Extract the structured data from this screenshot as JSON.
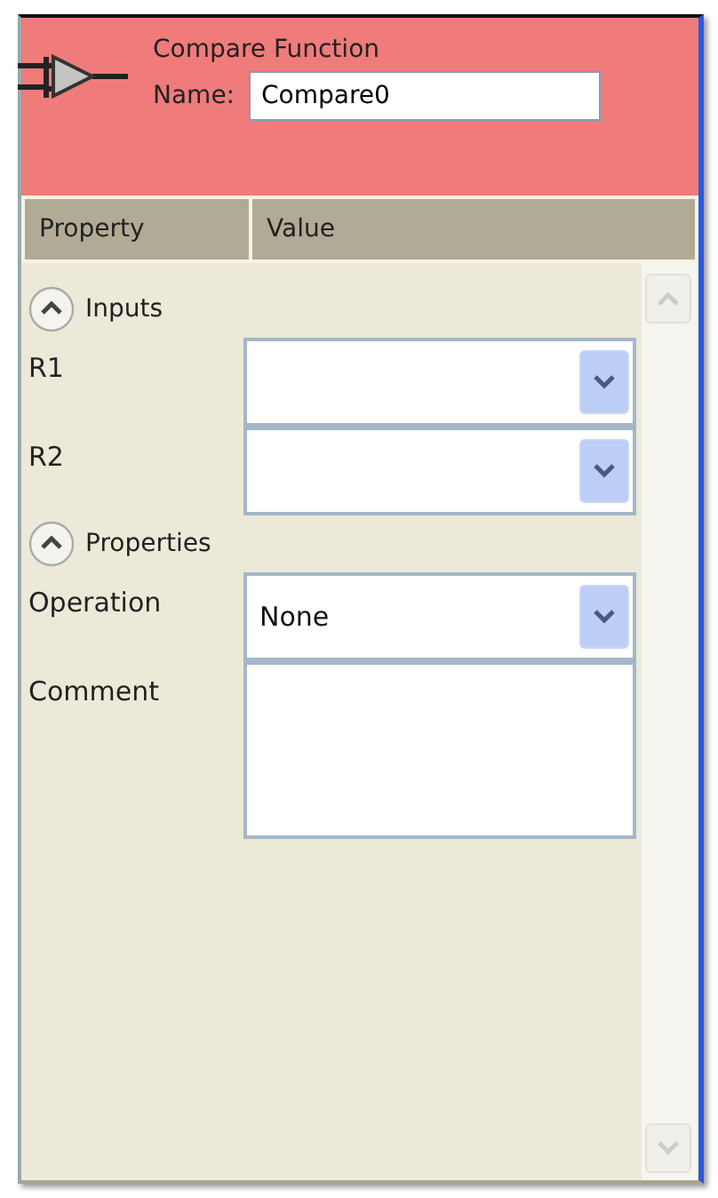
{
  "header": {
    "title": "Compare Function",
    "name_label": "Name:",
    "name_value": "Compare0"
  },
  "columns": [
    "Property",
    "Value"
  ],
  "sections": [
    {
      "label": "Inputs",
      "expanded": true,
      "rows": [
        {
          "label": "R1",
          "kind": "dropdown"
        },
        {
          "label": "R2",
          "kind": "dropdown"
        }
      ]
    },
    {
      "label": "Properties",
      "expanded": true,
      "rows": [
        {
          "label": "Operation",
          "kind": "dropdown",
          "value": "None"
        },
        {
          "label": "Comment",
          "kind": "textarea"
        }
      ]
    }
  ]
}
